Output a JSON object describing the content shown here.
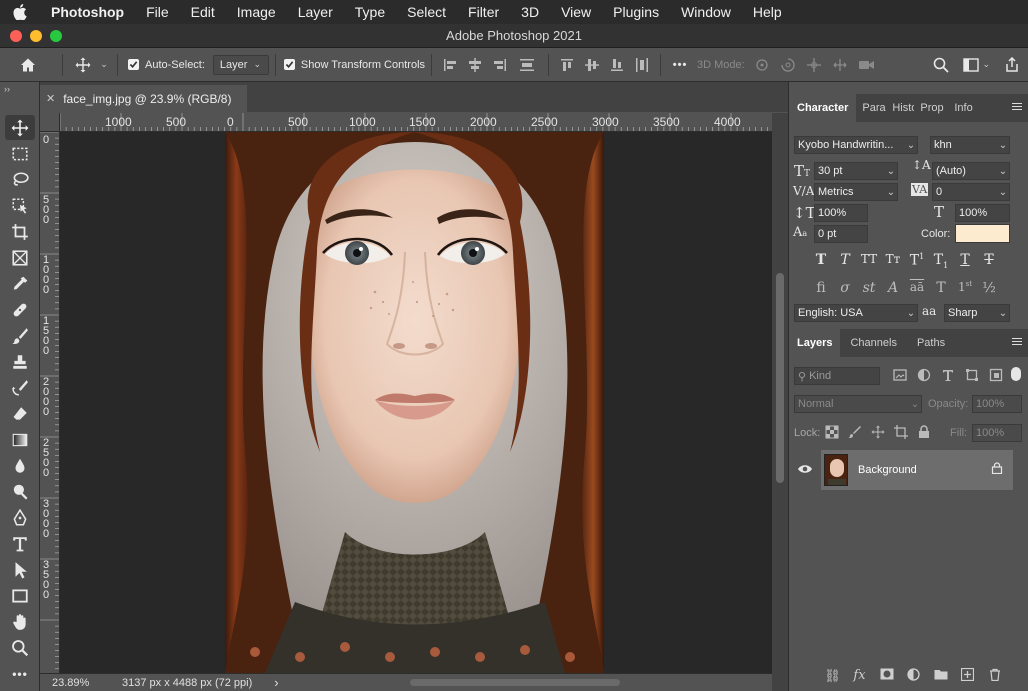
{
  "menubar": {
    "app_name": "Photoshop",
    "items": [
      "File",
      "Edit",
      "Image",
      "Layer",
      "Type",
      "Select",
      "Filter",
      "3D",
      "View",
      "Plugins",
      "Window",
      "Help"
    ]
  },
  "window": {
    "title": "Adobe Photoshop 2021"
  },
  "options_bar": {
    "auto_select_label": "Auto-Select:",
    "auto_select_value": "Layer",
    "show_transform_label": "Show Transform Controls",
    "more": "•••",
    "mode_3d_label": "3D Mode:"
  },
  "document": {
    "tab_title": "face_img.jpg @ 23.9% (RGB/8)",
    "h_ruler": [
      "1000",
      "500",
      "0",
      "500",
      "1000",
      "1500",
      "2000",
      "2500",
      "3000",
      "3500",
      "4000"
    ],
    "v_ruler": [
      "0",
      "5\n0\n0",
      "1\n0\n0\n0",
      "1\n5\n0\n0",
      "2\n0\n0\n0",
      "2\n5\n0\n0",
      "3\n0\n0\n0",
      "3\n5\n0\n0"
    ],
    "zoom": "23.89%",
    "doc_info": "3137 px x 4488 px (72 ppi)",
    "status_arrow": "›"
  },
  "character_panel": {
    "tabs": [
      "Character",
      "Para",
      "Histo",
      "Prop",
      "Info"
    ],
    "font_family": "Kyobo Handwritin...",
    "font_style": "khn",
    "font_size": "30 pt",
    "leading": "(Auto)",
    "kerning": "Metrics",
    "tracking": "0",
    "vertical_scale": "100%",
    "horizontal_scale": "100%",
    "baseline_shift": "0 pt",
    "color_label": "Color:",
    "color_swatch": "#fdebd0",
    "language": "English: USA",
    "antialias": "Sharp",
    "aa_glyph": "aa"
  },
  "layers_panel": {
    "tabs": [
      "Layers",
      "Channels",
      "Paths"
    ],
    "kind_filter": "Kind",
    "blend_mode": "Normal",
    "opacity_label": "Opacity:",
    "opacity_value": "100%",
    "lock_label": "Lock:",
    "fill_label": "Fill:",
    "fill_value": "100%",
    "layers": [
      {
        "name": "Background",
        "visible": true,
        "locked": true
      }
    ]
  }
}
